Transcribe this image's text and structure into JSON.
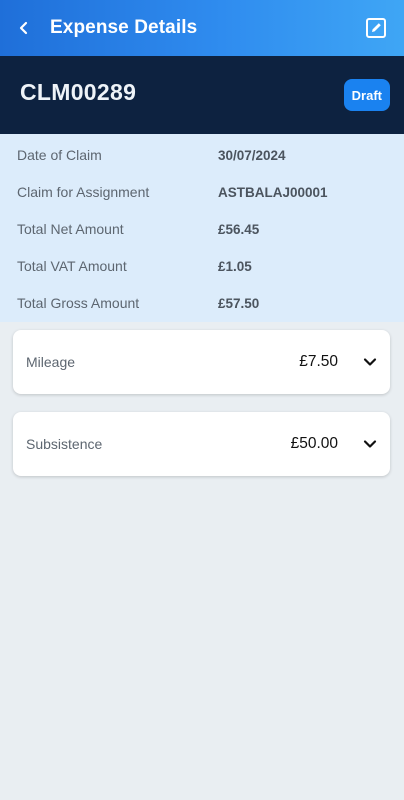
{
  "appbar": {
    "title": "Expense Details",
    "back_icon": "back-chevron-icon",
    "edit_icon": "edit-square-icon",
    "gradient_start": "#1f6fd9",
    "gradient_end": "#3fa6f5"
  },
  "claim": {
    "id": "CLM00289",
    "status": "Draft",
    "header_bg": "#0d2240",
    "badge_color": "#1a82f0"
  },
  "summary": {
    "rows": [
      {
        "label": "Date of Claim",
        "value": "30/07/2024"
      },
      {
        "label": "Claim for Assignment",
        "value": "ASTBALAJ00001"
      },
      {
        "label": "Total Net Amount",
        "value": "£56.45"
      },
      {
        "label": "Total VAT Amount",
        "value": "£1.05"
      },
      {
        "label": "Total Gross Amount",
        "value": "£57.50"
      }
    ]
  },
  "expenses": [
    {
      "label": "Mileage",
      "amount": "£7.50",
      "icon": "chevron-down-icon"
    },
    {
      "label": "Subsistence",
      "amount": "£50.00",
      "icon": "chevron-down-icon"
    }
  ]
}
